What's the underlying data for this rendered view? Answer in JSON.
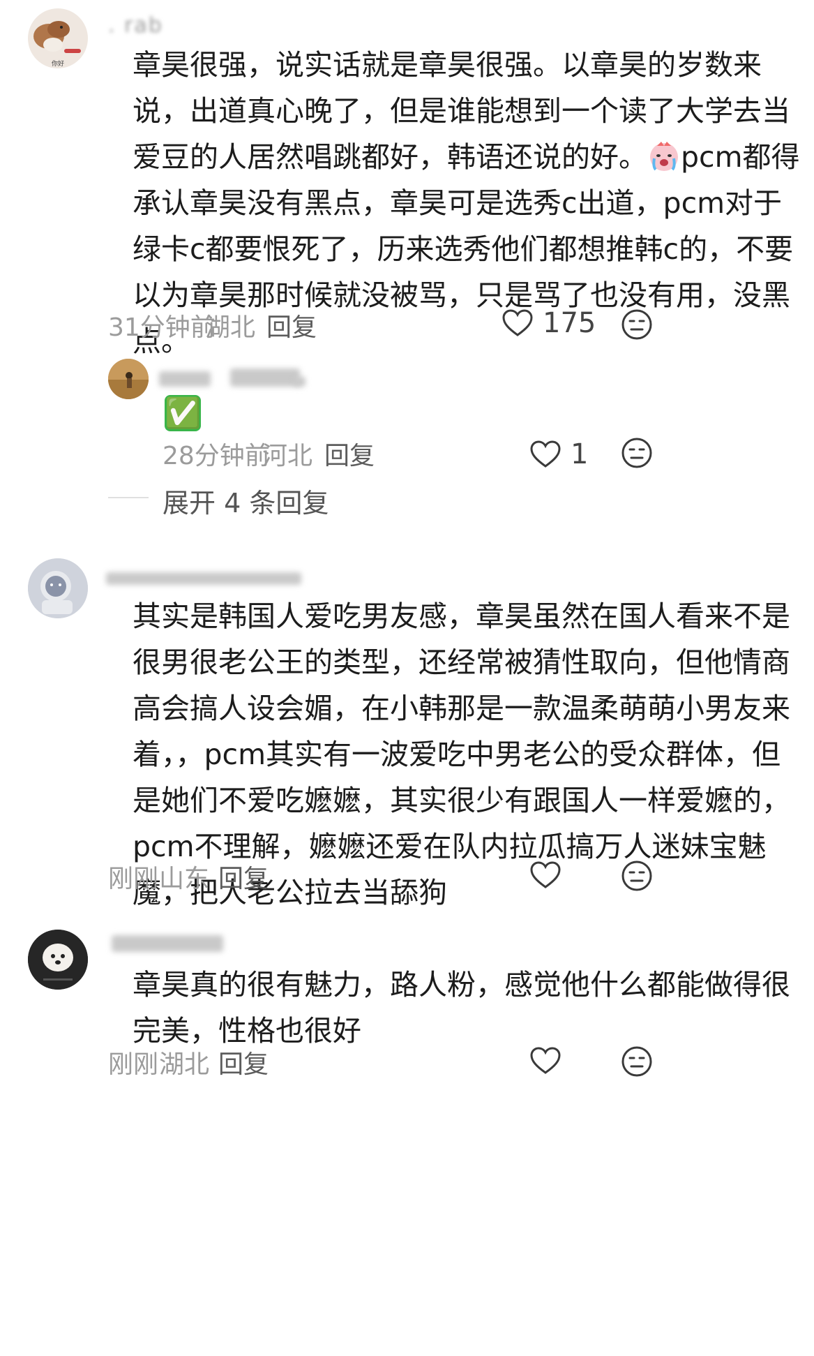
{
  "comments": [
    {
      "username": "  .  rab",
      "text": "章昊很强，说实话就是章昊很强。以章昊的岁数来说，出道真心晚了，但是谁能想到一个读了大学去当爱豆的人居然唱跳都好，韩语还说的好。",
      "text_after_emoji": "pcm都得承认章昊没有黑点，章昊可是选秀c出道，pcm对于绿卡c都要恨死了，历来选秀他们都想推韩c的，不要以为章昊那时候就没被骂，只是骂了也没有用，没黑点。",
      "time": "31分钟前",
      "location": "湖北",
      "reply_label": "回复",
      "likes": "175",
      "avatar_icon": "weasel-avatar-icon",
      "avatar_caption": "你好"
    },
    {
      "username": "",
      "text": "其实是韩国人爱吃男友感，章昊虽然在国人看来不是很男很老公王的类型，还经常被猜性取向，但他情商高会搞人设会媚，在小韩那是一款温柔萌萌小男友来着，，pcm其实有一波爱吃中男老公的受众群体，但是她们不爱吃嬷嬷，其实很少有跟国人一样爱嬷的，pcm不理解，嬷嬷还爱在队内拉瓜搞万人迷妹宝魅魔，把人老公拉去当舔狗",
      "time": "刚刚",
      "location": "山东",
      "reply_label": "回复",
      "avatar_icon": "astronaut-cat-avatar-icon"
    },
    {
      "username": "",
      "text": "章昊真的很有魅力，路人粉，感觉他什么都能做得很完美，性格也很好",
      "time": "刚刚",
      "location": "湖北",
      "reply_label": "回复",
      "avatar_icon": "white-dog-avatar-icon"
    }
  ],
  "reply": {
    "text_emoji": "✅",
    "time": "28分钟前",
    "location": "河北",
    "reply_label": "回复",
    "likes": "1",
    "avatar_icon": "field-person-avatar-icon"
  },
  "expand_label": "展开 4 条回复",
  "colors": {
    "text": "#1c1c1c",
    "meta": "#9b9b9b",
    "icon_stroke": "#3a3a3a",
    "check_green": "#39b54a"
  }
}
